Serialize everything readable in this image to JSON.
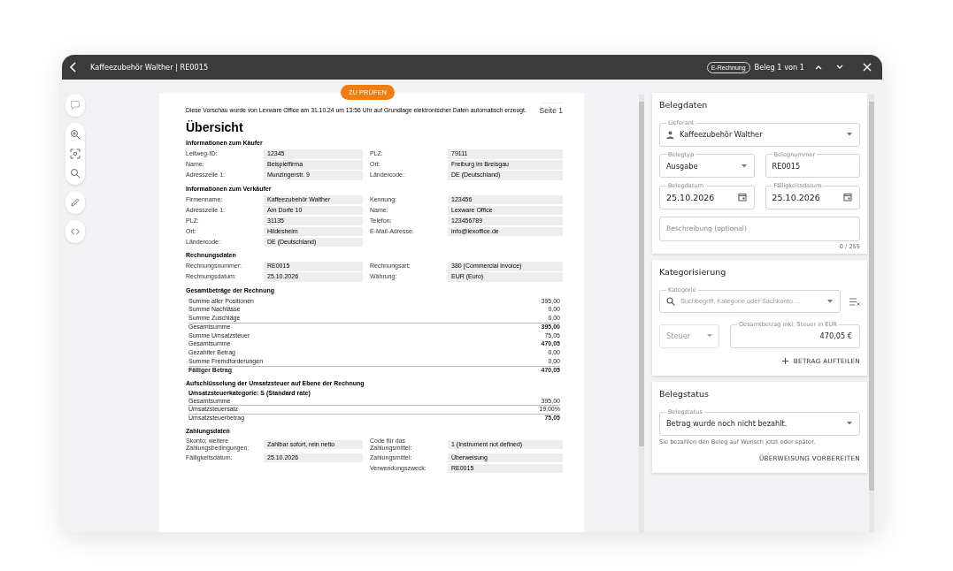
{
  "topbar": {
    "title": "Kaffeezubehör Walther | RE0015",
    "chip": "E-Rechnung",
    "counter": "Beleg 1 von 1"
  },
  "document": {
    "badge": "ZU PRÜFEN",
    "notice": "Diese Vorschau wurde von Lexware Office am 31.10.24 um 13:56 Uhr auf Grundlage elektronischer Daten automatisch erzeugt.",
    "page_label": "Seite 1",
    "heading": "Übersicht",
    "sections": [
      {
        "kind": "fields",
        "title": "Informationen zum Käufer",
        "rows": [
          {
            "left": {
              "label": "Leitweg-ID:",
              "value": "12345"
            },
            "right": {
              "label": "PLZ:",
              "value": "79111"
            }
          },
          {
            "left": {
              "label": "Name:",
              "value": "Beispielfirma"
            },
            "right": {
              "label": "Ort:",
              "value": "Freiburg im Breisgau"
            }
          },
          {
            "left": {
              "label": "Adresszeile 1:",
              "value": "Munzingerstr. 9"
            },
            "right": {
              "label": "Ländercode:",
              "value": "DE (Deutschland)"
            }
          }
        ]
      },
      {
        "kind": "fields",
        "title": "Informationen zum Verkäufer",
        "rows": [
          {
            "left": {
              "label": "Firmenname:",
              "value": "Kaffeezubehör Walther"
            },
            "right": {
              "label": "Kennung:",
              "value": "123456"
            }
          },
          {
            "left": {
              "label": "Adresszeile 1:",
              "value": "Am Dorfe 10"
            },
            "right": {
              "label": "Name:",
              "value": "Lexware Office"
            }
          },
          {
            "left": {
              "label": "PLZ:",
              "value": "31135"
            },
            "right": {
              "label": "Telefon:",
              "value": "123456789"
            }
          },
          {
            "left": {
              "label": "Ort:",
              "value": "Hildesheim"
            },
            "right": {
              "label": "E-Mail-Adresse:",
              "value": "info@lexoffice.de"
            }
          },
          {
            "left": {
              "label": "Ländercode:",
              "value": "DE (Deutschland)"
            }
          }
        ]
      },
      {
        "kind": "fields",
        "title": "Rechnungsdaten",
        "rows": [
          {
            "left": {
              "label": "Rechnungsnummer:",
              "value": "RE0015"
            },
            "right": {
              "label": "Rechnungsart:",
              "value": "380 (Commercial invoice)"
            }
          },
          {
            "left": {
              "label": "Rechnungsdatum:",
              "value": "25.10.2026"
            },
            "right": {
              "label": "Währung:",
              "value": "EUR (Euro)"
            }
          }
        ]
      },
      {
        "kind": "totals",
        "title": "Gesamtbeträge der Rechnung",
        "lines": [
          {
            "label": "Summe aller Positionen",
            "value": "395,00",
            "bold_label": false,
            "bold_value": false,
            "rule_above": false
          },
          {
            "label": "Summe Nachlässe",
            "value": "0,00",
            "bold_label": false,
            "bold_value": false,
            "rule_above": false
          },
          {
            "label": "Summe Zuschläge",
            "value": "0,00",
            "bold_label": false,
            "bold_value": false,
            "rule_above": false
          },
          {
            "label": "Gesamtsumme",
            "value": "395,00",
            "bold_label": false,
            "bold_value": true,
            "rule_above": true
          },
          {
            "label": "Summe Umsatzsteuer",
            "value": "75,05",
            "bold_label": false,
            "bold_value": false,
            "rule_above": false
          },
          {
            "label": "Gesamtsumme",
            "value": "470,05",
            "bold_label": false,
            "bold_value": true,
            "rule_above": false
          },
          {
            "label": "Gezahlter Betrag",
            "value": "0,00",
            "bold_label": false,
            "bold_value": false,
            "rule_above": false
          },
          {
            "label": "Summe Fremdforderungen",
            "value": "0,00",
            "bold_label": false,
            "bold_value": false,
            "rule_above": false
          },
          {
            "label": "Fälliger Betrag",
            "value": "470,05",
            "bold_label": true,
            "bold_value": true,
            "rule_above": true
          }
        ]
      },
      {
        "kind": "totals",
        "title": "Aufschlüsselung der Umsatzsteuer auf Ebene der Rechnung",
        "subtitle": "Umsatzsteuerkategorie: S (Standard rate)",
        "lines": [
          {
            "label": "Gesamtsumme",
            "value": "395,00",
            "bold_label": false,
            "bold_value": false,
            "rule_above": false
          },
          {
            "label": "Umsatzsteuersatz",
            "value": "19,00%",
            "bold_label": false,
            "bold_value": false,
            "rule_above": true
          },
          {
            "label": "Umsatzsteuerbetrag",
            "value": "75,05",
            "bold_label": false,
            "bold_value": true,
            "rule_above": true
          }
        ]
      },
      {
        "kind": "fields",
        "title": "Zahlungsdaten",
        "rows": [
          {
            "left": {
              "label": "Skonto; weitere Zahlungsbedingungen:",
              "value": "Zahlbar sofort, rein netto"
            },
            "right": {
              "label": "Code für das Zahlungsmittel:",
              "value": "1 (Instrument not defined)"
            }
          },
          {
            "left": {
              "label": "Fälligkeitsdatum:",
              "value": "25.10.2026"
            },
            "right": {
              "label": "Zahlungsmittel:",
              "value": "Überweisung"
            }
          },
          {
            "right": {
              "label": "Verwendungszweck:",
              "value": "RE0015"
            }
          }
        ]
      }
    ]
  },
  "belegdaten": {
    "title": "Belegdaten",
    "supplier": {
      "label": "Lieferant",
      "value": "Kaffeezubehör Walther"
    },
    "type": {
      "label": "Belegtyp",
      "value": "Ausgabe"
    },
    "number": {
      "label": "Belegnummer",
      "value": "RE0015"
    },
    "date": {
      "label": "Belegdatum",
      "value": "25.10.2026"
    },
    "due_date": {
      "label": "Fälligkeitsdatum",
      "value": "25.10.2026"
    },
    "description": {
      "placeholder": "Beschreibung (optional)",
      "counter": "0 / 255"
    }
  },
  "kategorisierung": {
    "title": "Kategorisierung",
    "category": {
      "label": "Kategorie",
      "placeholder": "Suchbegriff, Kategorie oder Sachkonto ..."
    },
    "tax": {
      "label": "Steuer",
      "disabled": true
    },
    "total": {
      "label": "Gesamtbetrag inkl. Steuer in EUR",
      "value": "470,05 €"
    },
    "split_button": "BETRAG AUFTEILEN"
  },
  "belegstatus": {
    "title": "Belegstatus",
    "status": {
      "label": "Belegstatus",
      "value": "Betrag wurde noch nicht bezahlt."
    },
    "hint": "Sie bezahlen den Beleg auf Wunsch jetzt oder später.",
    "button": "ÜBERWEISUNG VORBEREITEN"
  }
}
